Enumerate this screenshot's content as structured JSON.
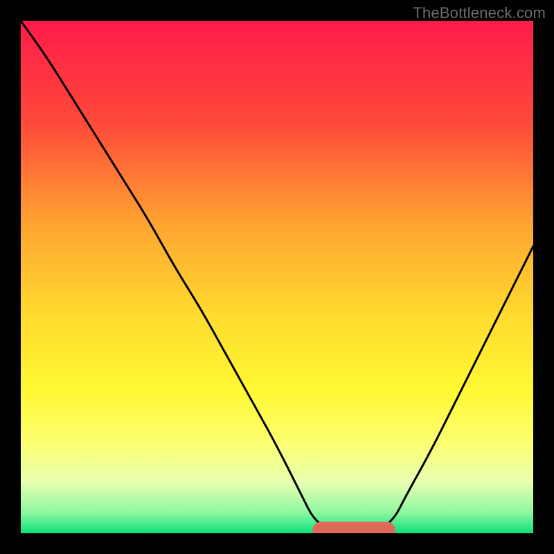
{
  "watermark": "TheBottleneck.com",
  "chart_data": {
    "type": "line",
    "title": "",
    "xlabel": "",
    "ylabel": "",
    "xlim": [
      0,
      100
    ],
    "ylim": [
      0,
      100
    ],
    "gradient_stops": [
      {
        "offset": 0,
        "color": "#ff1a4a"
      },
      {
        "offset": 0.2,
        "color": "#ff4a3a"
      },
      {
        "offset": 0.4,
        "color": "#ffa531"
      },
      {
        "offset": 0.58,
        "color": "#ffdc2e"
      },
      {
        "offset": 0.72,
        "color": "#fff833"
      },
      {
        "offset": 0.82,
        "color": "#fdff6e"
      },
      {
        "offset": 0.9,
        "color": "#e8ffb0"
      },
      {
        "offset": 0.96,
        "color": "#8cf7a0"
      },
      {
        "offset": 1.0,
        "color": "#0be07a"
      }
    ],
    "series": [
      {
        "name": "bottleneck-curve",
        "color": "#000000",
        "x": [
          0,
          5,
          10,
          15,
          20,
          25,
          30,
          35,
          40,
          45,
          50,
          55,
          57,
          60,
          65,
          70,
          73,
          75,
          80,
          85,
          90,
          95,
          100
        ],
        "y": [
          100,
          93,
          85,
          77,
          69,
          61,
          52,
          44,
          35,
          26,
          17,
          7,
          3,
          0.5,
          0.2,
          0.5,
          3,
          7,
          16,
          26,
          36,
          46,
          56
        ]
      }
    ],
    "flat_marker": {
      "name": "optimal-band",
      "color": "#e06a5a",
      "x_start": 57,
      "x_end": 73,
      "y": 0.6,
      "thickness": 2.0
    }
  }
}
